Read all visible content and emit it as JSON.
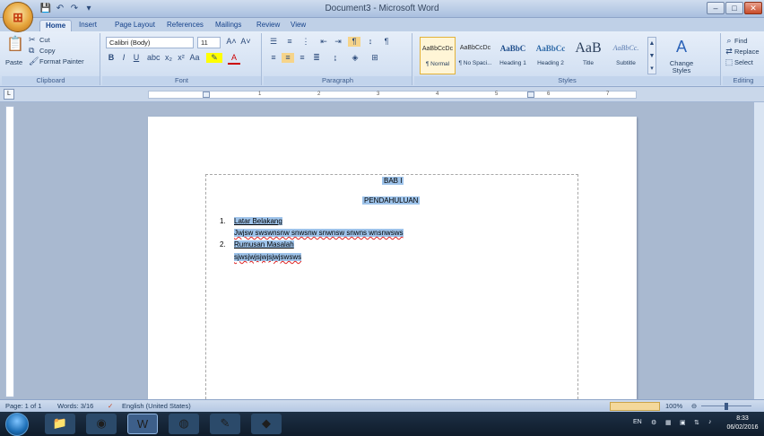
{
  "window": {
    "title": "Document3 - Microsoft Word",
    "controls": {
      "minimize": "–",
      "maximize": "□",
      "close": "✕"
    }
  },
  "quick_access": [
    "save-icon",
    "undo-icon",
    "redo-icon"
  ],
  "tabs": [
    {
      "label": "Home",
      "active": true
    },
    {
      "label": "Insert"
    },
    {
      "label": "Page Layout"
    },
    {
      "label": "References"
    },
    {
      "label": "Mailings"
    },
    {
      "label": "Review"
    },
    {
      "label": "View"
    }
  ],
  "ribbon": {
    "clipboard": {
      "title": "Clipboard",
      "paste": "Paste",
      "cut": "Cut",
      "copy": "Copy",
      "format_painter": "Format Painter"
    },
    "font": {
      "title": "Font",
      "font_name": "Calibri (Body)",
      "font_size": "11",
      "bold": "B",
      "italic": "I",
      "underline": "U",
      "grow": "A˄",
      "shrink": "A˅"
    },
    "paragraph": {
      "title": "Paragraph"
    },
    "styles": {
      "title": "Styles",
      "items": [
        {
          "sample": "AaBbCcDc",
          "name": "¶ Normal",
          "selected": true
        },
        {
          "sample": "AaBbCcDc",
          "name": "¶ No Spaci..."
        },
        {
          "sample": "AaBbC",
          "name": "Heading 1"
        },
        {
          "sample": "AaBbCc",
          "name": "Heading 2"
        },
        {
          "sample": "AaB",
          "name": "Title"
        },
        {
          "sample": "AaBbCc.",
          "name": "Subtitle"
        }
      ],
      "change_styles": "Change Styles"
    },
    "editing": {
      "title": "Editing",
      "find": "Find",
      "replace": "Replace",
      "select": "Select"
    }
  },
  "ruler": {
    "marks": [
      "1",
      "2",
      "3",
      "4",
      "5",
      "6",
      "7"
    ]
  },
  "document": {
    "heading1": "BAB I",
    "heading2": "PENDAHULUAN",
    "list": [
      {
        "num": "1.",
        "title": "Latar Belakang",
        "body": "Jwjsw swswnsnw snwsnw snwnsw snwns wnsnwsws"
      },
      {
        "num": "2.",
        "title": "Rumusan Masalah",
        "body": "sjwsjwjsjwjsjwjswsws"
      }
    ]
  },
  "status": {
    "page": "Page: 1 of 1",
    "words": "Words: 3/16",
    "language": "English (United States)",
    "zoom": "100%"
  },
  "taskbar": {
    "language": "EN",
    "time": "8:33",
    "date": "06/02/2016"
  }
}
